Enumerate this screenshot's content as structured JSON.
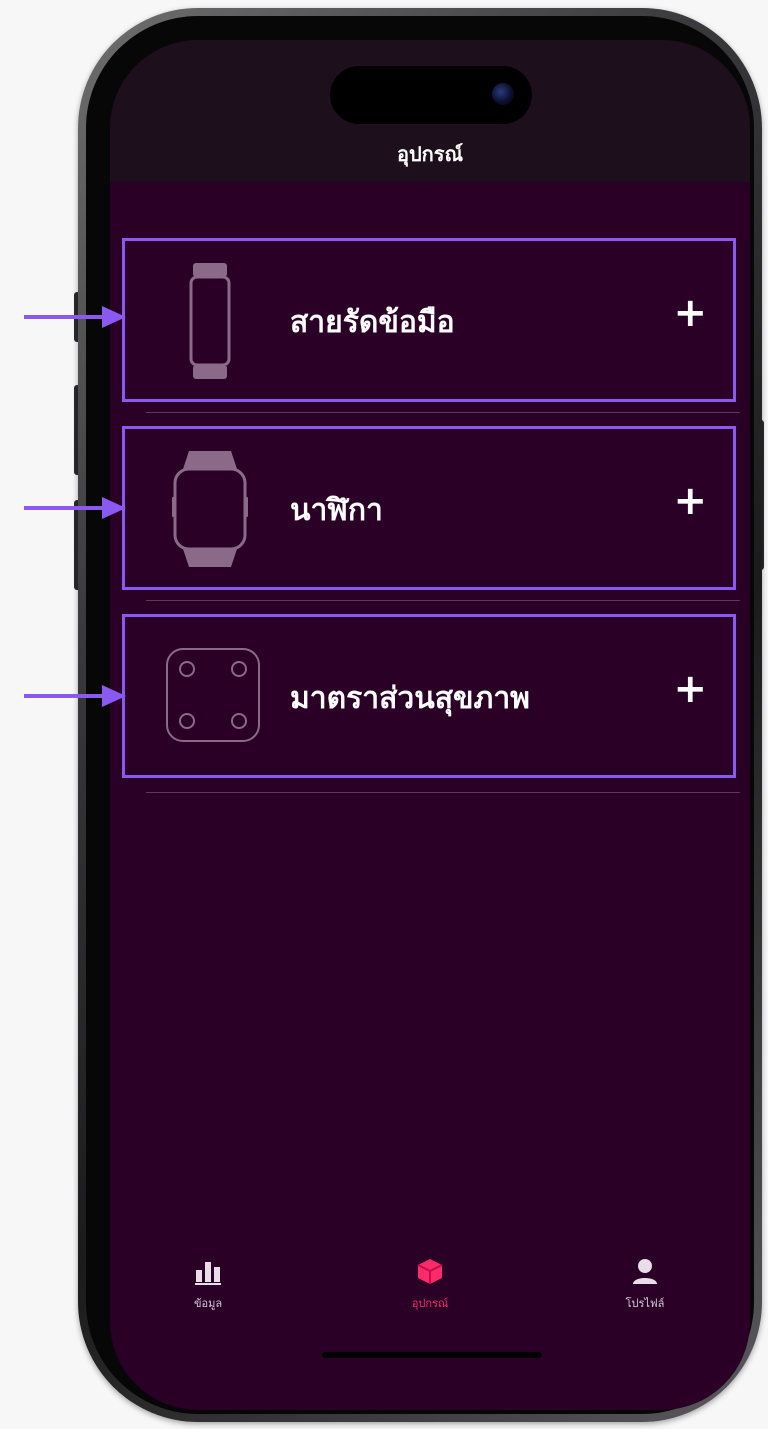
{
  "header": {
    "title": "อุปกรณ์"
  },
  "devices": [
    {
      "label": "สายรัดข้อมือ",
      "icon": "wristband-icon",
      "action": "+"
    },
    {
      "label": "นาฬิกา",
      "icon": "watch-icon",
      "action": "+"
    },
    {
      "label": "มาตราส่วนสุขภาพ",
      "icon": "scale-icon",
      "action": "+"
    }
  ],
  "tabs": [
    {
      "label": "ข้อมูล",
      "icon": "bar-chart-icon"
    },
    {
      "label": "อุปกรณ์",
      "icon": "devices-icon",
      "active": true
    },
    {
      "label": "โปรไฟล์",
      "icon": "profile-icon"
    }
  ],
  "colors": {
    "screen_bg": "#2a0026",
    "header_bg": "#1e0f1d",
    "highlight_border": "#8a5af0",
    "active_tab": "#ff2a6a",
    "icon_fill": "#8a6a88"
  }
}
